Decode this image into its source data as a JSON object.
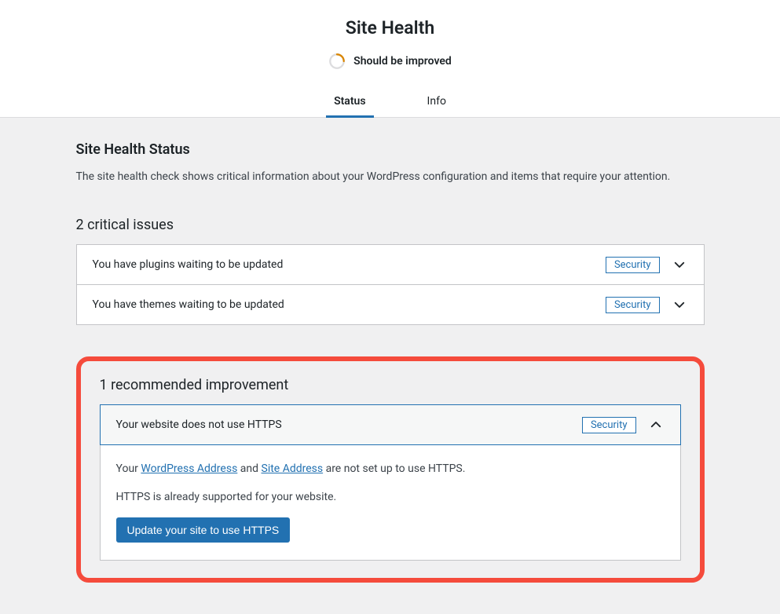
{
  "header": {
    "title": "Site Health",
    "status_label": "Should be improved",
    "tabs": {
      "status": "Status",
      "info": "Info"
    }
  },
  "status_section": {
    "heading": "Site Health Status",
    "description": "The site health check shows critical information about your WordPress configuration and items that require your attention."
  },
  "critical": {
    "heading": "2 critical issues",
    "items": [
      {
        "title": "You have plugins waiting to be updated",
        "badge": "Security"
      },
      {
        "title": "You have themes waiting to be updated",
        "badge": "Security"
      }
    ]
  },
  "recommended": {
    "heading": "1 recommended improvement",
    "item": {
      "title": "Your website does not use HTTPS",
      "badge": "Security",
      "body_prefix": "Your ",
      "link1": "WordPress Address",
      "body_and": " and ",
      "link2": "Site Address",
      "body_suffix": " are not set up to use HTTPS.",
      "body2": "HTTPS is already supported for your website.",
      "button": "Update your site to use HTTPS"
    }
  }
}
